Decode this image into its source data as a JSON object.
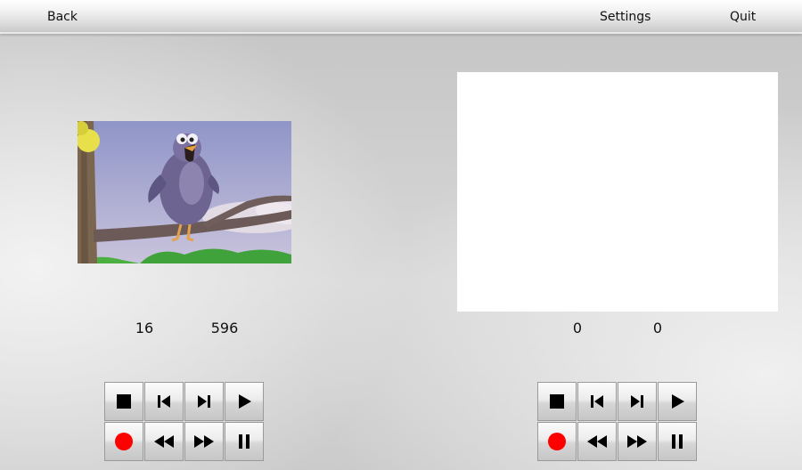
{
  "topbar": {
    "back_label": "Back",
    "settings_label": "Settings",
    "quit_label": "Quit"
  },
  "left_player": {
    "counter_a": "16",
    "counter_b": "596"
  },
  "right_player": {
    "counter_a": "0",
    "counter_b": "0"
  },
  "colors": {
    "record": "#ff0000",
    "icon": "#000000",
    "right_video_bg": "#ffffff"
  },
  "icons": {
    "stop": "stop-icon",
    "skip_back": "skip-back-icon",
    "skip_forward": "skip-forward-icon",
    "play": "play-icon",
    "record": "record-icon",
    "rewind": "rewind-icon",
    "fast_forward": "fast-forward-icon",
    "pause": "pause-icon"
  }
}
